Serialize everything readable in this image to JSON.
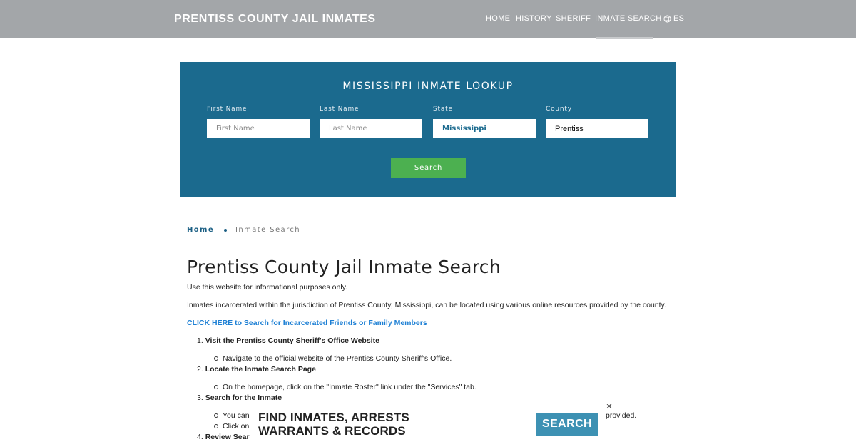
{
  "header": {
    "site_title": "PRENTISS COUNTY JAIL INMATES",
    "nav": {
      "home": "HOME",
      "history": "HISTORY",
      "sheriff": "SHERIFF",
      "inmate_search": "INMATE SEARCH",
      "language": "ES",
      "language_icon": "globe-icon"
    }
  },
  "search_panel": {
    "title": "MISSISSIPPI INMATE LOOKUP",
    "first_name": {
      "label": "First Name",
      "placeholder": "First Name",
      "value": ""
    },
    "last_name": {
      "label": "Last Name",
      "placeholder": "Last Name",
      "value": ""
    },
    "state": {
      "label": "State",
      "value": "Mississippi"
    },
    "county": {
      "label": "County",
      "value": "Prentiss"
    },
    "button": "Search"
  },
  "breadcrumb": {
    "home": "Home",
    "current": "Inmate Search"
  },
  "content": {
    "title": "Prentiss County Jail Inmate Search",
    "intro": "Use this website for informational purposes only.",
    "paragraph": "Inmates incarcerated within the jurisdiction of Prentiss County, Mississippi, can be located using various online resources provided by the county.",
    "link": "CLICK HERE to Search for Incarcerated Friends or Family Members",
    "steps": [
      {
        "number": "1.",
        "title": "Visit the Prentiss County Sheriff's Office Website",
        "subitems": [
          "Navigate to the official website of the Prentiss County Sheriff's Office."
        ]
      },
      {
        "number": "2.",
        "title": "Locate the Inmate Search Page",
        "subitems": [
          "On the homepage, click on the \"Inmate Roster\" link under the \"Services\" tab."
        ]
      },
      {
        "number": "3.",
        "title": "Search for the Inmate",
        "subitems": [
          "You can",
          "Click on"
        ]
      },
      {
        "number": "4.",
        "title": "Review Searcl",
        "subitems": []
      }
    ],
    "trailing_text": "provided."
  },
  "ad": {
    "line1": "FIND INMATES, ARRESTS",
    "line2": "WARRANTS & RECORDS",
    "button": "SEARCH",
    "close": "✕"
  },
  "colors": {
    "header_bg": "#a3a6a9",
    "panel_bg": "#1b6a8e",
    "search_button": "#4cb050",
    "link": "#1c7fd4",
    "ad_button": "#3d91b3"
  }
}
